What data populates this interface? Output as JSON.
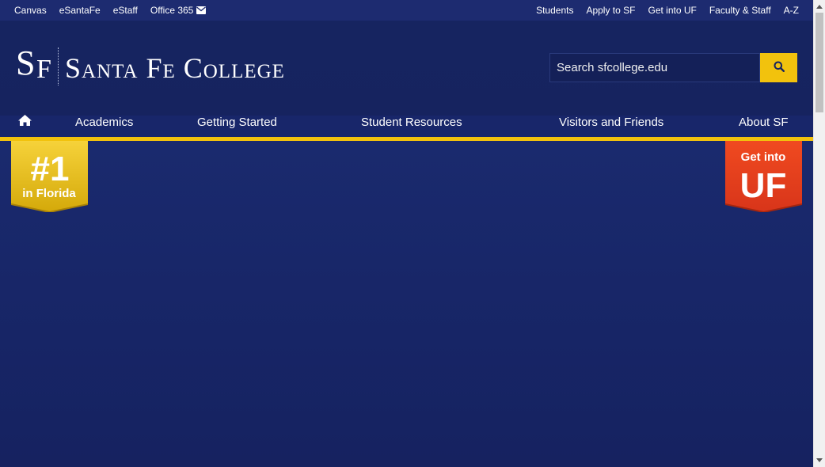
{
  "utility": {
    "left_links": [
      "Canvas",
      "eSantaFe",
      "eStaff",
      "Office 365"
    ],
    "right_links": [
      "Students",
      "Apply to SF",
      "Get into UF",
      "Faculty & Staff",
      "A-Z"
    ],
    "office_icon": "envelope-icon"
  },
  "logo": {
    "mark_s": "S",
    "mark_f": "F",
    "name": "Santa Fe College"
  },
  "search": {
    "placeholder": "Search sfcollege.edu",
    "button_icon": "search-icon"
  },
  "nav": {
    "home_icon": "home-icon",
    "items": [
      "Academics",
      "Getting Started",
      "Student Resources",
      "Visitors and Friends",
      "About SF"
    ]
  },
  "badges": {
    "left": {
      "line1": "#1",
      "line2": "in Florida"
    },
    "right": {
      "line1": "Get into",
      "line2": "UF"
    }
  },
  "colors": {
    "navy": "#18266a",
    "gold": "#f2c20d",
    "uf_orange": "#e8401c"
  }
}
